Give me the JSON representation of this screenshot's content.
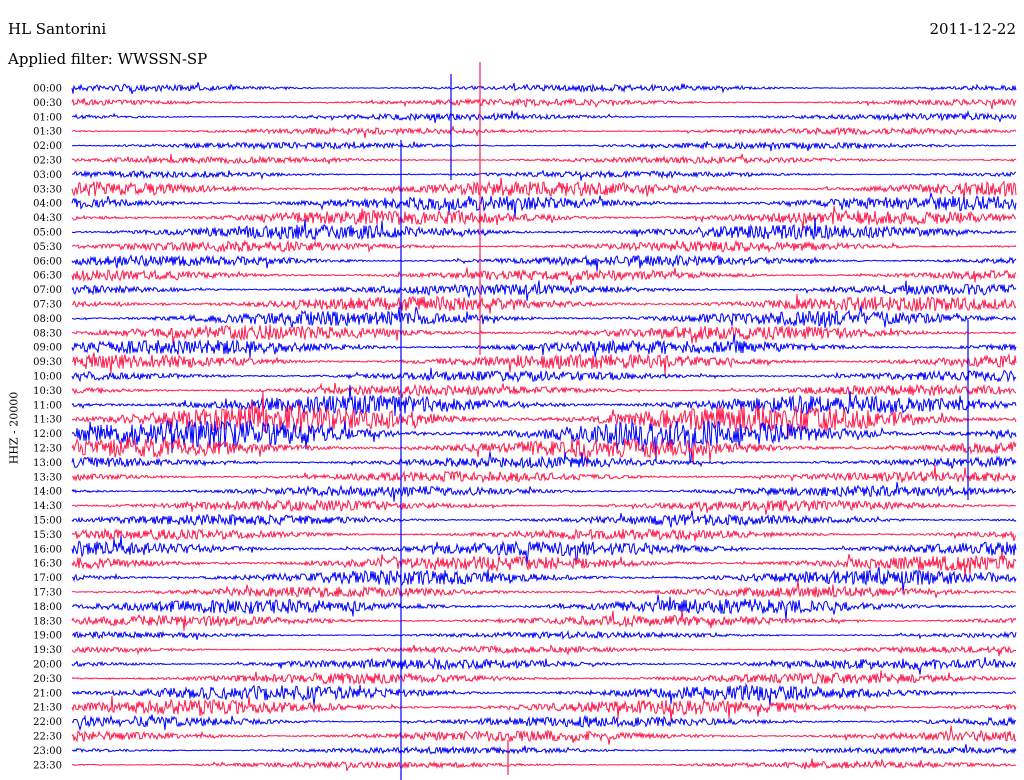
{
  "header": {
    "station": "HL Santorini",
    "date": "2011-12-22",
    "filter": "Applied filter: WWSSN-SP"
  },
  "colors": {
    "series_a": "#0000ff",
    "series_b": "#ff1a4d"
  },
  "chart_data": {
    "type": "line",
    "title": "HL Santorini",
    "ylabel": "HHZ - 20000",
    "row_labels": [
      "00:00",
      "00:30",
      "01:00",
      "01:30",
      "02:00",
      "02:30",
      "03:00",
      "03:30",
      "04:00",
      "04:30",
      "05:00",
      "05:30",
      "06:00",
      "06:30",
      "07:00",
      "07:30",
      "08:00",
      "08:30",
      "09:00",
      "09:30",
      "10:00",
      "10:30",
      "11:00",
      "11:30",
      "12:00",
      "12:30",
      "13:00",
      "13:30",
      "14:00",
      "14:30",
      "15:00",
      "15:30",
      "16:00",
      "16:30",
      "17:00",
      "17:30",
      "18:00",
      "18:30",
      "19:00",
      "19:30",
      "20:00",
      "20:30",
      "21:00",
      "21:30",
      "22:00",
      "22:30",
      "23:00",
      "23:30"
    ],
    "series": [
      {
        "color": "#0000ff",
        "rows": "even"
      },
      {
        "color": "#ff1a4d",
        "rows": "odd"
      }
    ],
    "row_amplitude_level": [
      1,
      1,
      1,
      1,
      1,
      1,
      1,
      3,
      3,
      3,
      3,
      2,
      2,
      2,
      2,
      3,
      3,
      3,
      3,
      3,
      2,
      2,
      4,
      6,
      6,
      4,
      2,
      2,
      2,
      2,
      2,
      2,
      3,
      3,
      3,
      2,
      3,
      2,
      1,
      1,
      2,
      2,
      3,
      3,
      2,
      2,
      1,
      1
    ],
    "grid": false
  }
}
